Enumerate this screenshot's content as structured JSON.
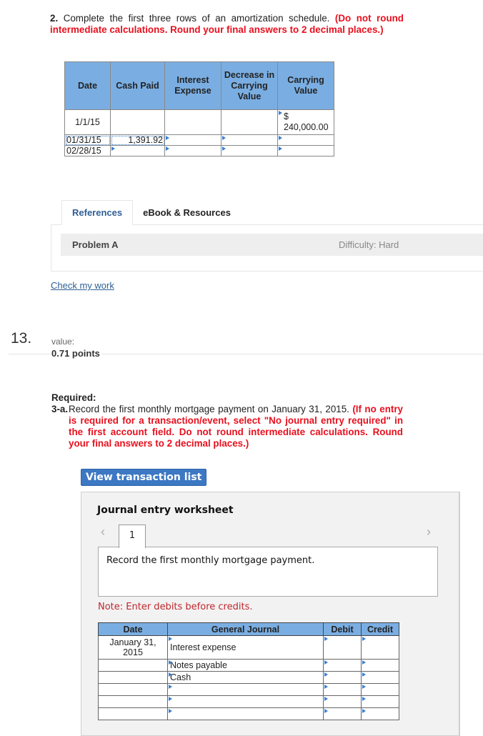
{
  "question2": {
    "number": "2.",
    "text": "Complete the first three rows of an amortization schedule.",
    "instruction": "(Do not round intermediate calculations. Round your final answers to 2 decimal places.)"
  },
  "amortization": {
    "headers": [
      "Date",
      "Cash Paid",
      "Interest Expense",
      "Decrease in Carrying Value",
      "Carrying Value"
    ],
    "rows": [
      {
        "date": "1/1/15",
        "cash_paid": "",
        "interest_expense": "",
        "decrease": "",
        "carrying_value": "$ 240,000.00"
      },
      {
        "date": "01/31/15",
        "cash_paid": "1,391.92",
        "interest_expense": "",
        "decrease": "",
        "carrying_value": ""
      },
      {
        "date": "02/28/15",
        "cash_paid": "",
        "interest_expense": "",
        "decrease": "",
        "carrying_value": ""
      }
    ]
  },
  "tabs": [
    {
      "label": "References",
      "active": true
    },
    {
      "label": "eBook & Resources",
      "active": false
    }
  ],
  "problem": {
    "name": "Problem A",
    "difficulty": "Difficulty: Hard"
  },
  "check_my_work": "Check my work",
  "question13": {
    "number": "13.",
    "value_label": "value:",
    "points": "0.71 points"
  },
  "required": {
    "heading": "Required:",
    "part_label": "3-a.",
    "text": "Record the first monthly mortgage payment on January 31, 2015.",
    "instruction": "(If no entry is required for a transaction/event, select \"No journal entry required\" in the first account field. Do not round intermediate calculations. Round your final answers to 2 decimal places.)"
  },
  "view_transaction_list": "View transaction list",
  "worksheet": {
    "title": "Journal entry worksheet",
    "active_tab": "1",
    "description": "Record the first monthly mortgage payment.",
    "note": "Note: Enter debits before credits.",
    "headers": [
      "Date",
      "General Journal",
      "Debit",
      "Credit"
    ],
    "rows": [
      {
        "date": "January 31, 2015",
        "account": "Interest expense",
        "debit": "",
        "credit": ""
      },
      {
        "date": "",
        "account": "Notes payable",
        "debit": "",
        "credit": ""
      },
      {
        "date": "",
        "account": "Cash",
        "debit": "",
        "credit": ""
      },
      {
        "date": "",
        "account": "",
        "debit": "",
        "credit": ""
      },
      {
        "date": "",
        "account": "",
        "debit": "",
        "credit": ""
      },
      {
        "date": "",
        "account": "",
        "debit": "",
        "credit": ""
      }
    ]
  },
  "colors": {
    "header_blue": "#7aaee2",
    "instruction_red": "#e8101e",
    "button_blue": "#3c78c3",
    "link_blue": "#2f5f95"
  }
}
